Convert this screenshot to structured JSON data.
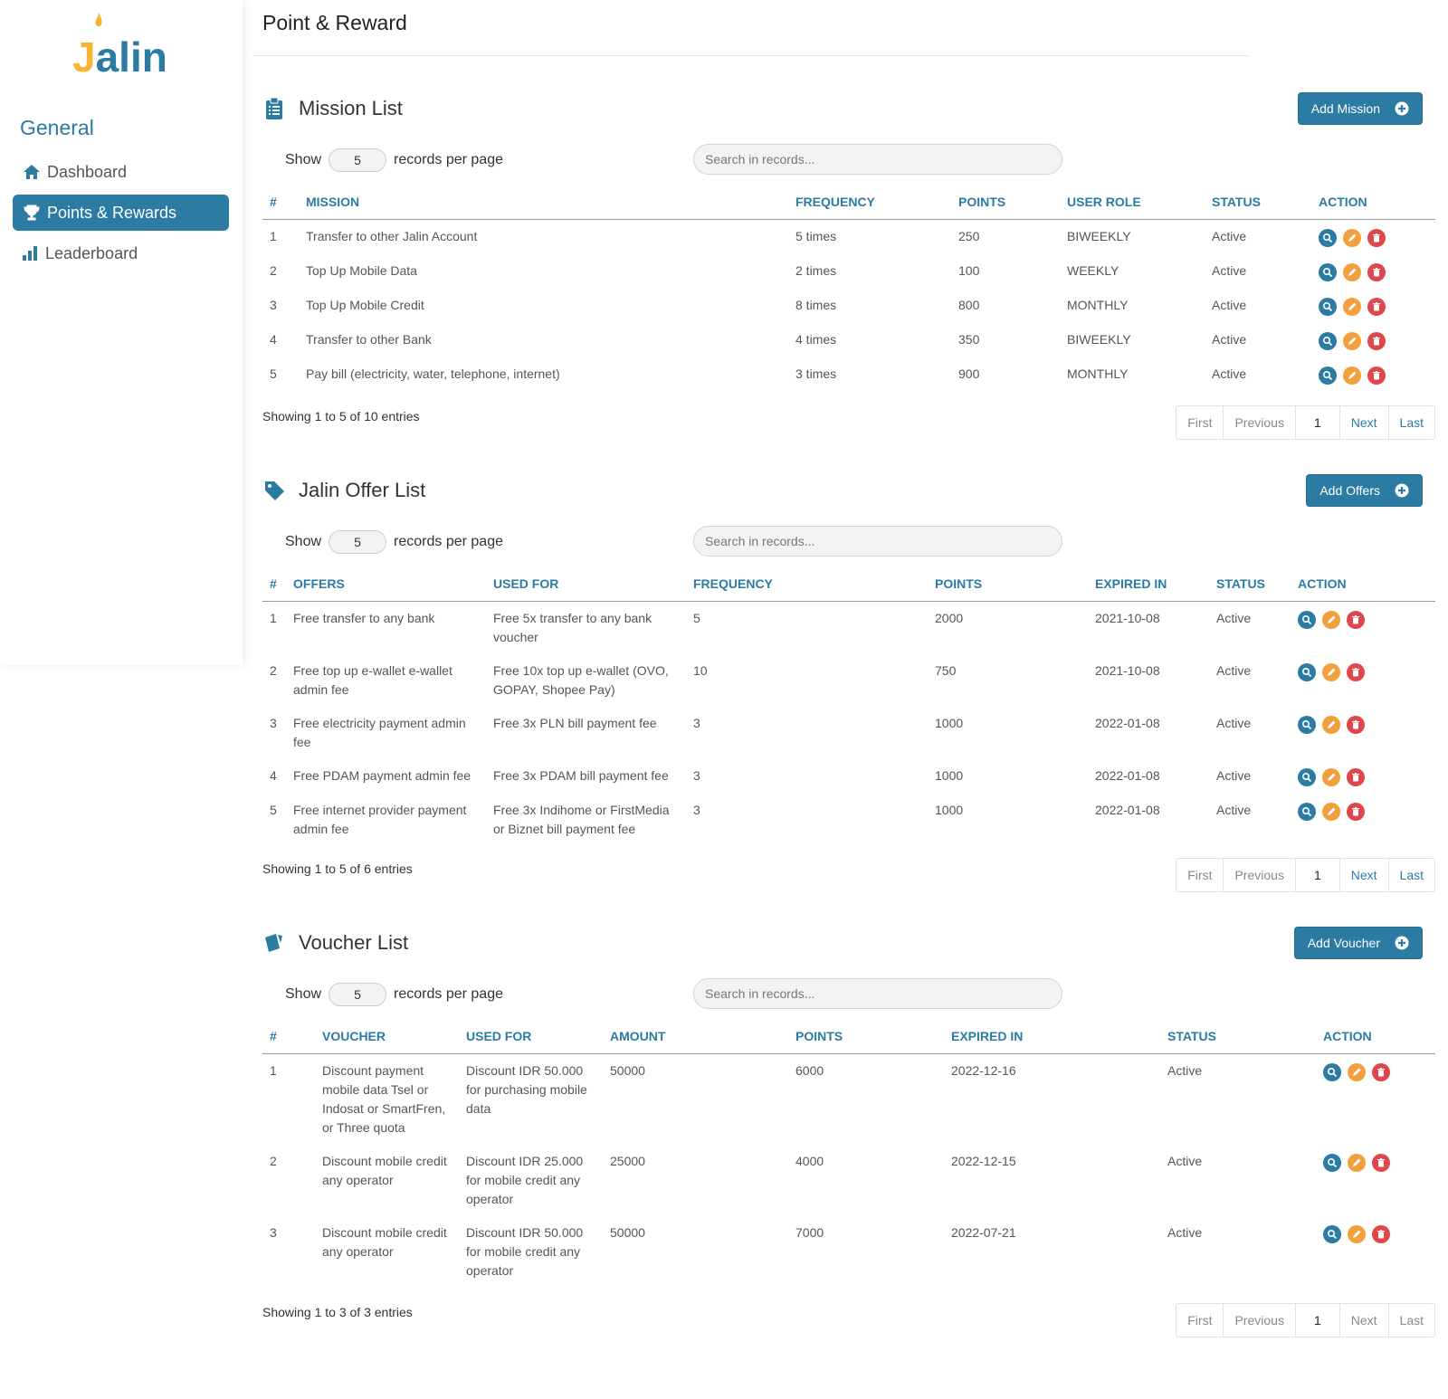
{
  "brand": {
    "logo_text": "Jalin"
  },
  "sidebar": {
    "heading": "General",
    "items": [
      {
        "label": "Dashboard",
        "icon": "home-icon"
      },
      {
        "label": "Points & Rewards",
        "icon": "trophy-icon",
        "active": true
      },
      {
        "label": "Leaderboard",
        "icon": "bar-chart-icon"
      }
    ]
  },
  "header": {
    "title": "Point & Reward"
  },
  "common": {
    "show_label": "Show",
    "per_page": "5",
    "records_label": "records per page",
    "search_placeholder": "Search in records...",
    "pager": {
      "first": "First",
      "previous": "Previous",
      "page": "1",
      "next": "Next",
      "last": "Last"
    }
  },
  "missions": {
    "title": "Mission List",
    "add_label": "Add Mission",
    "columns": [
      "#",
      "MISSION",
      "FREQUENCY",
      "POINTS",
      "USER ROLE",
      "STATUS",
      "ACTION"
    ],
    "rows": [
      [
        "1",
        "Transfer to other Jalin Account",
        "5 times",
        "250",
        "BIWEEKLY",
        "Active"
      ],
      [
        "2",
        "Top Up Mobile Data",
        "2 times",
        "100",
        "WEEKLY",
        "Active"
      ],
      [
        "3",
        "Top Up Mobile Credit",
        "8 times",
        "800",
        "MONTHLY",
        "Active"
      ],
      [
        "4",
        "Transfer to other Bank",
        "4 times",
        "350",
        "BIWEEKLY",
        "Active"
      ],
      [
        "5",
        "Pay bill (electricity, water, telephone, internet)",
        "3 times",
        "900",
        "MONTHLY",
        "Active"
      ]
    ],
    "showing": "Showing 1 to 5 of 10 entries"
  },
  "offers": {
    "title": "Jalin Offer List",
    "add_label": "Add Offers",
    "columns": [
      "#",
      "OFFERS",
      "USED FOR",
      "FREQUENCY",
      "POINTS",
      "EXPIRED IN",
      "STATUS",
      "ACTION"
    ],
    "rows": [
      [
        "1",
        "Free transfer to any bank",
        "Free 5x transfer to any bank voucher",
        "5",
        "2000",
        "2021-10-08",
        "Active"
      ],
      [
        "2",
        "Free top up e-wallet e-wallet admin fee",
        "Free 10x top up e-wallet (OVO, GOPAY, Shopee Pay)",
        "10",
        "750",
        "2021-10-08",
        "Active"
      ],
      [
        "3",
        "Free electricity payment admin fee",
        "Free 3x PLN bill payment fee",
        "3",
        "1000",
        "2022-01-08",
        "Active"
      ],
      [
        "4",
        "Free PDAM payment admin fee",
        "Free 3x PDAM bill payment fee",
        "3",
        "1000",
        "2022-01-08",
        "Active"
      ],
      [
        "5",
        "Free internet provider payment admin fee",
        "Free 3x Indihome or FirstMedia or Biznet bill payment fee",
        "3",
        "1000",
        "2022-01-08",
        "Active"
      ]
    ],
    "showing": "Showing 1 to 5 of 6 entries"
  },
  "vouchers": {
    "title": "Voucher List",
    "add_label": "Add Voucher",
    "columns": [
      "#",
      "VOUCHER",
      "USED FOR",
      "AMOUNT",
      "POINTS",
      "EXPIRED IN",
      "STATUS",
      "ACTION"
    ],
    "rows": [
      [
        "1",
        "Discount payment mobile data Tsel or Indosat or SmartFren, or Three quota",
        "Discount IDR 50.000 for purchasing mobile data",
        "50000",
        "6000",
        "2022-12-16",
        "Active"
      ],
      [
        "2",
        "Discount mobile credit any operator",
        "Discount IDR 25.000 for mobile credit any operator",
        "25000",
        "4000",
        "2022-12-15",
        "Active"
      ],
      [
        "3",
        "Discount mobile credit any operator",
        "Discount IDR 50.000 for mobile credit any operator",
        "50000",
        "7000",
        "2022-07-21",
        "Active"
      ]
    ],
    "showing": "Showing 1 to 3 of 3 entries"
  },
  "colors": {
    "primary": "#2b7ba3",
    "edit": "#f2a03d",
    "delete": "#e0474c",
    "accent_logo": "#f4b532"
  }
}
